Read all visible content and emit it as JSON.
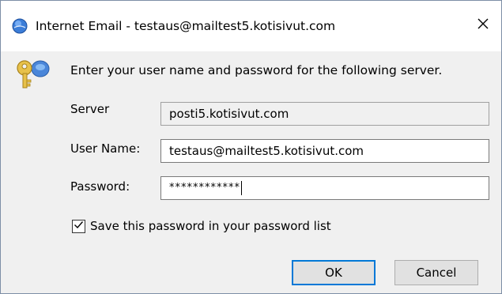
{
  "window": {
    "title": "Internet Email - testaus@mailtest5.kotisivut.com"
  },
  "prompt": "Enter your user name and password for the following server.",
  "form": {
    "server_label": "Server",
    "server_value": "posti5.kotisivut.com",
    "username_label": "User Name:",
    "username_value": "testaus@mailtest5.kotisivut.com",
    "password_label": "Password:",
    "password_value": "************"
  },
  "save_password": {
    "label": "Save this password in your password list",
    "checked": true
  },
  "buttons": {
    "ok": "OK",
    "cancel": "Cancel"
  },
  "colors": {
    "accent": "#0078d7",
    "dialog_bg": "#f0f0f0"
  },
  "icons": [
    "outlook-globe-icon",
    "keys-icon",
    "close-icon",
    "checkmark-icon"
  ]
}
